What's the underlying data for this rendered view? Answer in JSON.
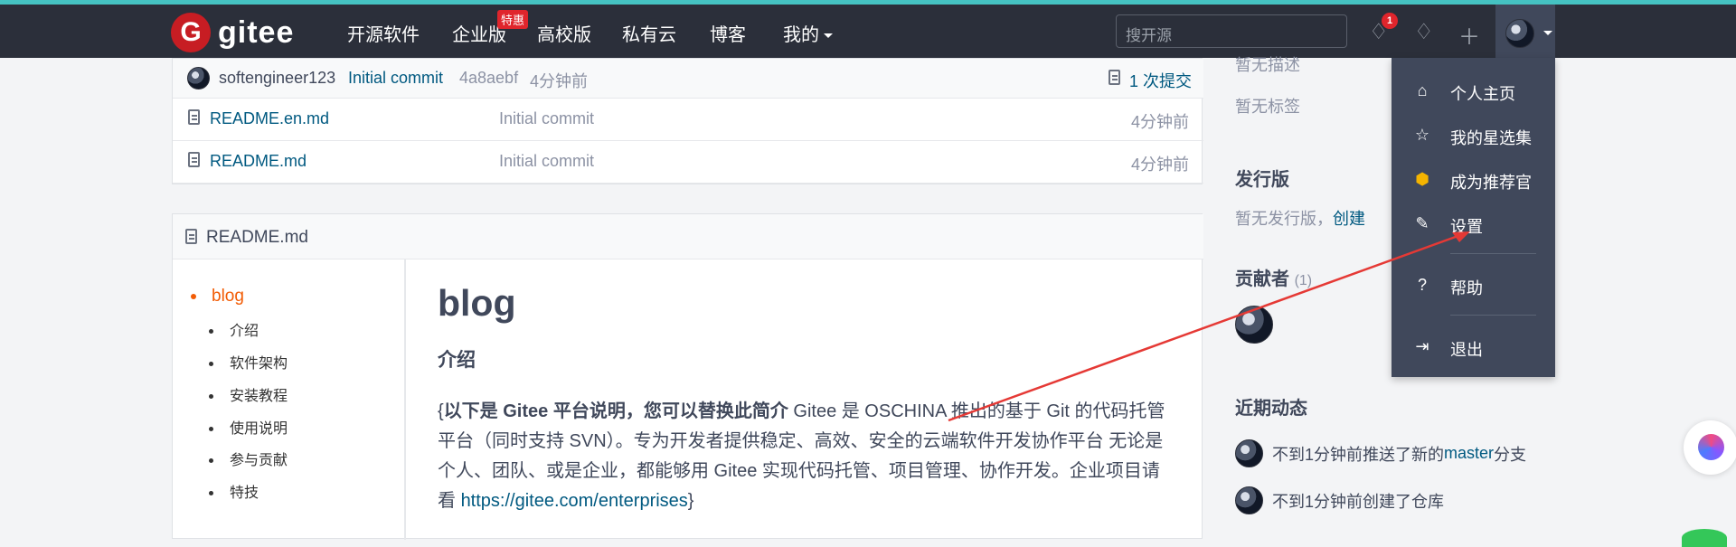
{
  "navbar": {
    "brand": "gitee",
    "logo_glyph": "G",
    "items": [
      "开源软件",
      "企业版",
      "高校版",
      "私有云",
      "博客",
      "我的"
    ],
    "enterprise_badge": "特惠",
    "search_placeholder": "搜开源",
    "notification_count": "1",
    "icons": [
      "bell-icon",
      "lightbulb-icon",
      "plus-icon"
    ]
  },
  "repo": {
    "last_commit": {
      "user": "softengineer123",
      "message": "Initial commit",
      "hash": "4a8aebf",
      "time": "4分钟前",
      "commit_count": "1 次提交"
    },
    "files": [
      {
        "name": "README.en.md",
        "message": "Initial commit",
        "time": "4分钟前"
      },
      {
        "name": "README.md",
        "message": "Initial commit",
        "time": "4分钟前"
      }
    ]
  },
  "readme": {
    "filename": "README.md",
    "toc": {
      "main": "blog",
      "items": [
        "介绍",
        "软件架构",
        "安装教程",
        "使用说明",
        "参与贡献",
        "特技"
      ]
    },
    "title": "blog",
    "section": "介绍",
    "paragraph_prefix": "{",
    "paragraph_bold": "以下是 Gitee 平台说明，您可以替换此简介",
    "paragraph_body_1": " Gitee 是 OSCHINA 推出的基于 Git 的代码托管平台（同时支持 SVN）。专为开发者提供稳定、高效、安全的云端软件开发协作平台 无论是个人、团队、或是企业，都能够用 Gitee 实现代码托管、项目管理、协作开发。企业项目请看 ",
    "link": "https://gitee.com/enterprises",
    "paragraph_suffix": "}"
  },
  "sidebar": {
    "description": "暂无描述",
    "tags": "暂无标签",
    "release_title": "发行版",
    "release_text": "暂无发行版，",
    "release_create": "创建",
    "contributors_title": "贡献者",
    "contributors_count": "(1)",
    "activity_title": "近期动态",
    "activity_1_prefix": "不到1分钟前推送了新的 ",
    "activity_1_branch": "master",
    "activity_1_suffix": " 分支",
    "activity_2": "不到1分钟前创建了仓库"
  },
  "user_menu": {
    "items": [
      {
        "label": "个人主页",
        "icon": "home-icon"
      },
      {
        "label": "我的星选集",
        "icon": "star-icon"
      },
      {
        "label": "成为推荐官",
        "icon": "recommend-icon"
      },
      {
        "label": "设置",
        "icon": "settings-edit-icon"
      },
      {
        "label": "帮助",
        "icon": "help-icon"
      },
      {
        "label": "退出",
        "icon": "logout-icon"
      }
    ]
  },
  "colors": {
    "navbar": "#2b2f3a",
    "menu": "#40485b",
    "brand_red": "#c71d23",
    "accent_orange": "#f25c05",
    "link_blue": "#005980",
    "annotation_red": "#e53935"
  }
}
